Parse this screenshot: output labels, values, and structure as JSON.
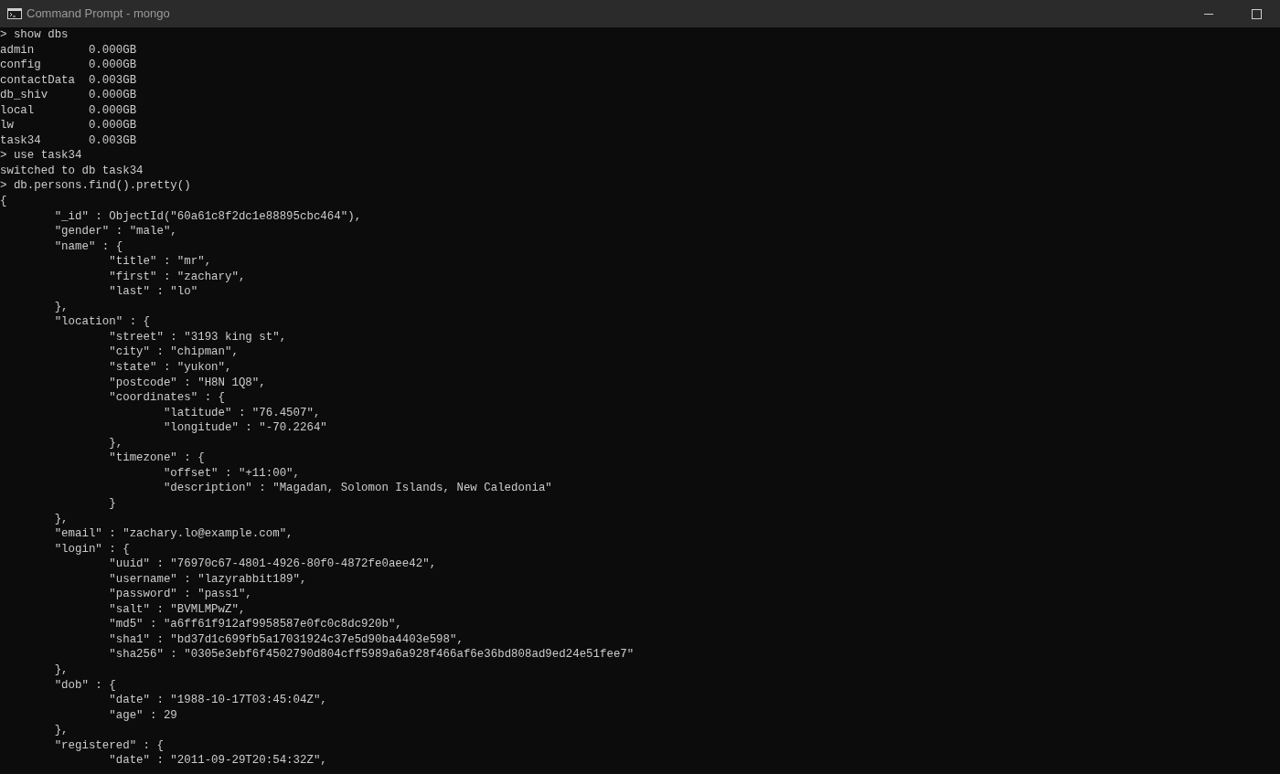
{
  "window": {
    "title": "Command Prompt - mongo"
  },
  "console": {
    "lines": [
      "> show dbs",
      "admin        0.000GB",
      "config       0.000GB",
      "contactData  0.003GB",
      "db_shiv      0.000GB",
      "local        0.000GB",
      "lw           0.000GB",
      "task34       0.003GB",
      "> use task34",
      "switched to db task34",
      "> db.persons.find().pretty()",
      "{",
      "\t\"_id\" : ObjectId(\"60a61c8f2dc1e88895cbc464\"),",
      "\t\"gender\" : \"male\",",
      "\t\"name\" : {",
      "\t\t\"title\" : \"mr\",",
      "\t\t\"first\" : \"zachary\",",
      "\t\t\"last\" : \"lo\"",
      "\t},",
      "\t\"location\" : {",
      "\t\t\"street\" : \"3193 king st\",",
      "\t\t\"city\" : \"chipman\",",
      "\t\t\"state\" : \"yukon\",",
      "\t\t\"postcode\" : \"H8N 1Q8\",",
      "\t\t\"coordinates\" : {",
      "\t\t\t\"latitude\" : \"76.4507\",",
      "\t\t\t\"longitude\" : \"-70.2264\"",
      "\t\t},",
      "\t\t\"timezone\" : {",
      "\t\t\t\"offset\" : \"+11:00\",",
      "\t\t\t\"description\" : \"Magadan, Solomon Islands, New Caledonia\"",
      "\t\t}",
      "\t},",
      "\t\"email\" : \"zachary.lo@example.com\",",
      "\t\"login\" : {",
      "\t\t\"uuid\" : \"76970c67-4801-4926-80f0-4872fe0aee42\",",
      "\t\t\"username\" : \"lazyrabbit189\",",
      "\t\t\"password\" : \"pass1\",",
      "\t\t\"salt\" : \"BVMLMPwZ\",",
      "\t\t\"md5\" : \"a6ff61f912af9958587e0fc0c8dc920b\",",
      "\t\t\"sha1\" : \"bd37d1c699fb5a17031924c37e5d90ba4403e598\",",
      "\t\t\"sha256\" : \"0305e3ebf6f4502790d804cff5989a6a928f466af6e36bd808ad9ed24e51fee7\"",
      "\t},",
      "\t\"dob\" : {",
      "\t\t\"date\" : \"1988-10-17T03:45:04Z\",",
      "\t\t\"age\" : 29",
      "\t},",
      "\t\"registered\" : {",
      "\t\t\"date\" : \"2011-09-29T20:54:32Z\","
    ]
  }
}
